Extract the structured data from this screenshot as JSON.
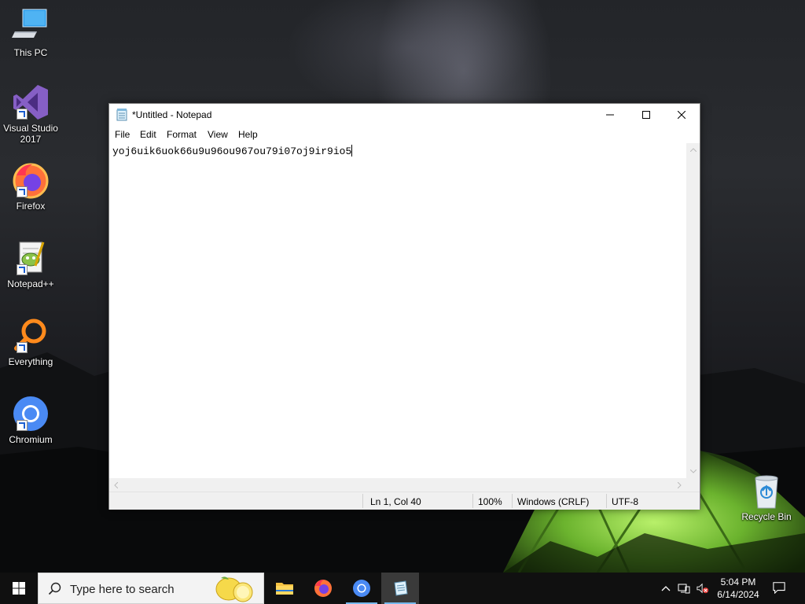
{
  "desktop": {
    "icons": [
      {
        "label": "This PC",
        "icon": "computer-icon"
      },
      {
        "label": "Visual Studio 2017",
        "icon": "visual-studio-icon"
      },
      {
        "label": "Firefox",
        "icon": "firefox-icon"
      },
      {
        "label": "Notepad++",
        "icon": "notepad-plus-plus-icon"
      },
      {
        "label": "Everything",
        "icon": "everything-search-icon"
      },
      {
        "label": "Chromium",
        "icon": "chromium-icon"
      }
    ],
    "recycle_bin": {
      "label": "Recycle Bin",
      "icon": "recycle-bin-icon"
    }
  },
  "notepad": {
    "title": "*Untitled - Notepad",
    "menu": [
      "File",
      "Edit",
      "Format",
      "View",
      "Help"
    ],
    "content": "yoj6uik6uok66u9u96ou967ou79i07oj9ir9io5",
    "status": {
      "position": "Ln 1, Col 40",
      "zoom": "100%",
      "line_ending": "Windows (CRLF)",
      "encoding": "UTF-8"
    }
  },
  "taskbar": {
    "search_placeholder": "Type here to search",
    "apps": [
      {
        "name": "File Explorer",
        "icon": "folder-icon"
      },
      {
        "name": "Firefox",
        "icon": "firefox-icon"
      },
      {
        "name": "Chromium",
        "icon": "chromium-icon"
      },
      {
        "name": "Notepad",
        "icon": "notepad-icon"
      }
    ],
    "clock": {
      "time": "5:04 PM",
      "date": "6/14/2024"
    }
  },
  "colors": {
    "taskbar": "#101010",
    "accent": "#76b9ed",
    "tent_green": "#7cc243"
  }
}
